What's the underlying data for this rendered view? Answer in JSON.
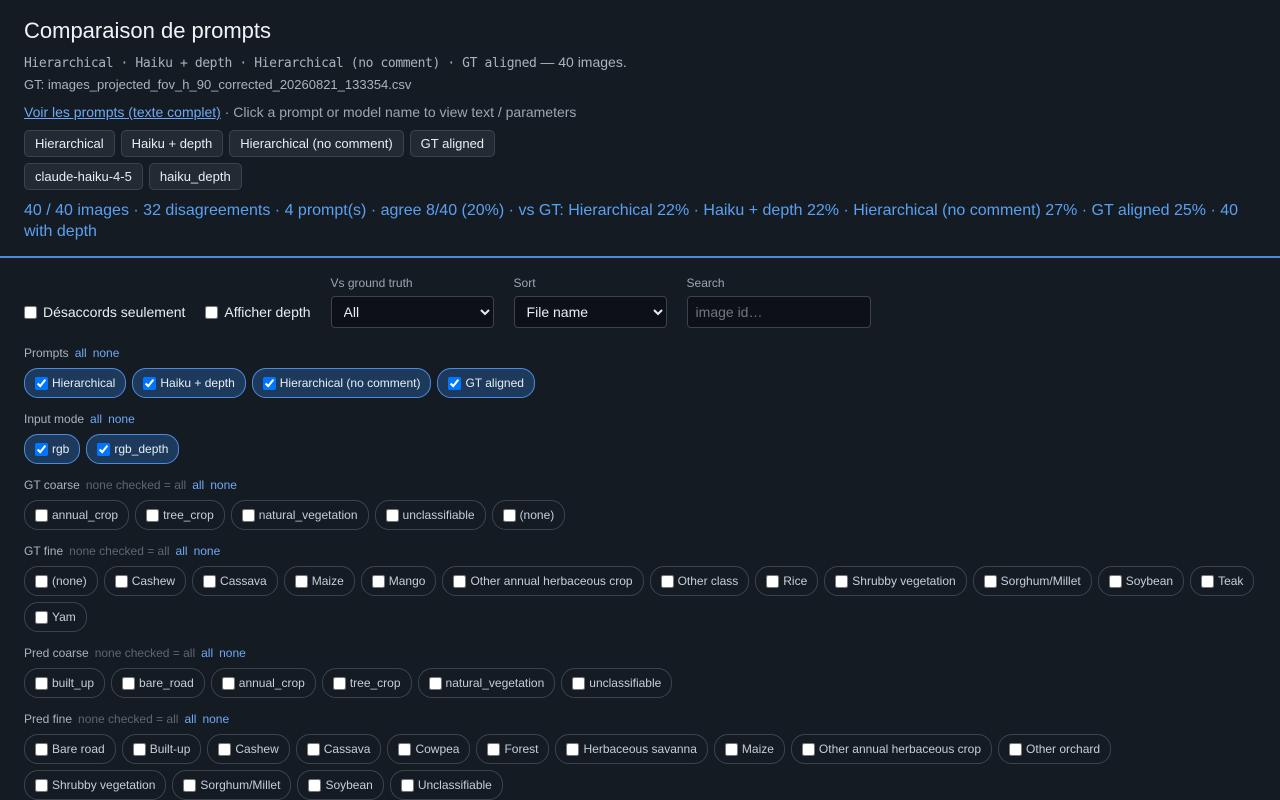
{
  "header": {
    "title": "Comparaison de prompts",
    "prompts_list": "Hierarchical · Haiku + depth · Hierarchical (no comment) · GT aligned",
    "image_count_suffix": "— 40 images.",
    "gt_file": "GT: images_projected_fov_h_90_corrected_20260821_133354.csv",
    "view_prompts_link": "Voir les prompts (texte complet)",
    "hint": "·  Click a prompt or model name to view text / parameters",
    "prompt_buttons": [
      "Hierarchical",
      "Haiku + depth",
      "Hierarchical (no comment)",
      "GT aligned"
    ],
    "model_buttons": [
      "claude-haiku-4-5",
      "haiku_depth"
    ],
    "stats": "40 / 40 images · 32 disagreements · 4 prompt(s) · agree 8/40 (20%) · vs GT: Hierarchical 22% · Haiku + depth 22% · Hierarchical (no comment) 27% · GT aligned 25% · 40 with depth"
  },
  "controls": {
    "disagreements_only_label": "Désaccords seulement",
    "show_depth_label": "Afficher depth",
    "vs_gt_label": "Vs ground truth",
    "vs_gt_value": "All",
    "sort_label": "Sort",
    "sort_value": "File name",
    "search_label": "Search",
    "search_placeholder": "image id…"
  },
  "filters": {
    "all_label": "all",
    "none_label": "none",
    "hint_none": "none checked = all",
    "prompts": {
      "label": "Prompts",
      "items": [
        {
          "label": "Hierarchical",
          "checked": true
        },
        {
          "label": "Haiku + depth",
          "checked": true
        },
        {
          "label": "Hierarchical (no comment)",
          "checked": true
        },
        {
          "label": "GT aligned",
          "checked": true
        }
      ]
    },
    "input_mode": {
      "label": "Input mode",
      "items": [
        {
          "label": "rgb",
          "checked": true
        },
        {
          "label": "rgb_depth",
          "checked": true
        }
      ]
    },
    "gt_coarse": {
      "label": "GT coarse",
      "items": [
        {
          "label": "annual_crop"
        },
        {
          "label": "tree_crop"
        },
        {
          "label": "natural_vegetation"
        },
        {
          "label": "unclassifiable"
        },
        {
          "label": "(none)"
        }
      ]
    },
    "gt_fine": {
      "label": "GT fine",
      "items": [
        {
          "label": "(none)"
        },
        {
          "label": "Cashew"
        },
        {
          "label": "Cassava"
        },
        {
          "label": "Maize"
        },
        {
          "label": "Mango"
        },
        {
          "label": "Other annual herbaceous crop"
        },
        {
          "label": "Other class"
        },
        {
          "label": "Rice"
        },
        {
          "label": "Shrubby vegetation"
        },
        {
          "label": "Sorghum/Millet"
        },
        {
          "label": "Soybean"
        },
        {
          "label": "Teak"
        },
        {
          "label": "Yam"
        }
      ]
    },
    "pred_coarse": {
      "label": "Pred coarse",
      "items": [
        {
          "label": "built_up"
        },
        {
          "label": "bare_road"
        },
        {
          "label": "annual_crop"
        },
        {
          "label": "tree_crop"
        },
        {
          "label": "natural_vegetation"
        },
        {
          "label": "unclassifiable"
        }
      ]
    },
    "pred_fine": {
      "label": "Pred fine",
      "items": [
        {
          "label": "Bare road"
        },
        {
          "label": "Built-up"
        },
        {
          "label": "Cashew"
        },
        {
          "label": "Cassava"
        },
        {
          "label": "Cowpea"
        },
        {
          "label": "Forest"
        },
        {
          "label": "Herbaceous savanna"
        },
        {
          "label": "Maize"
        },
        {
          "label": "Other annual herbaceous crop"
        },
        {
          "label": "Other orchard"
        },
        {
          "label": "Shrubby vegetation"
        },
        {
          "label": "Sorghum/Millet"
        },
        {
          "label": "Soybean"
        },
        {
          "label": "Unclassifiable"
        }
      ]
    }
  }
}
